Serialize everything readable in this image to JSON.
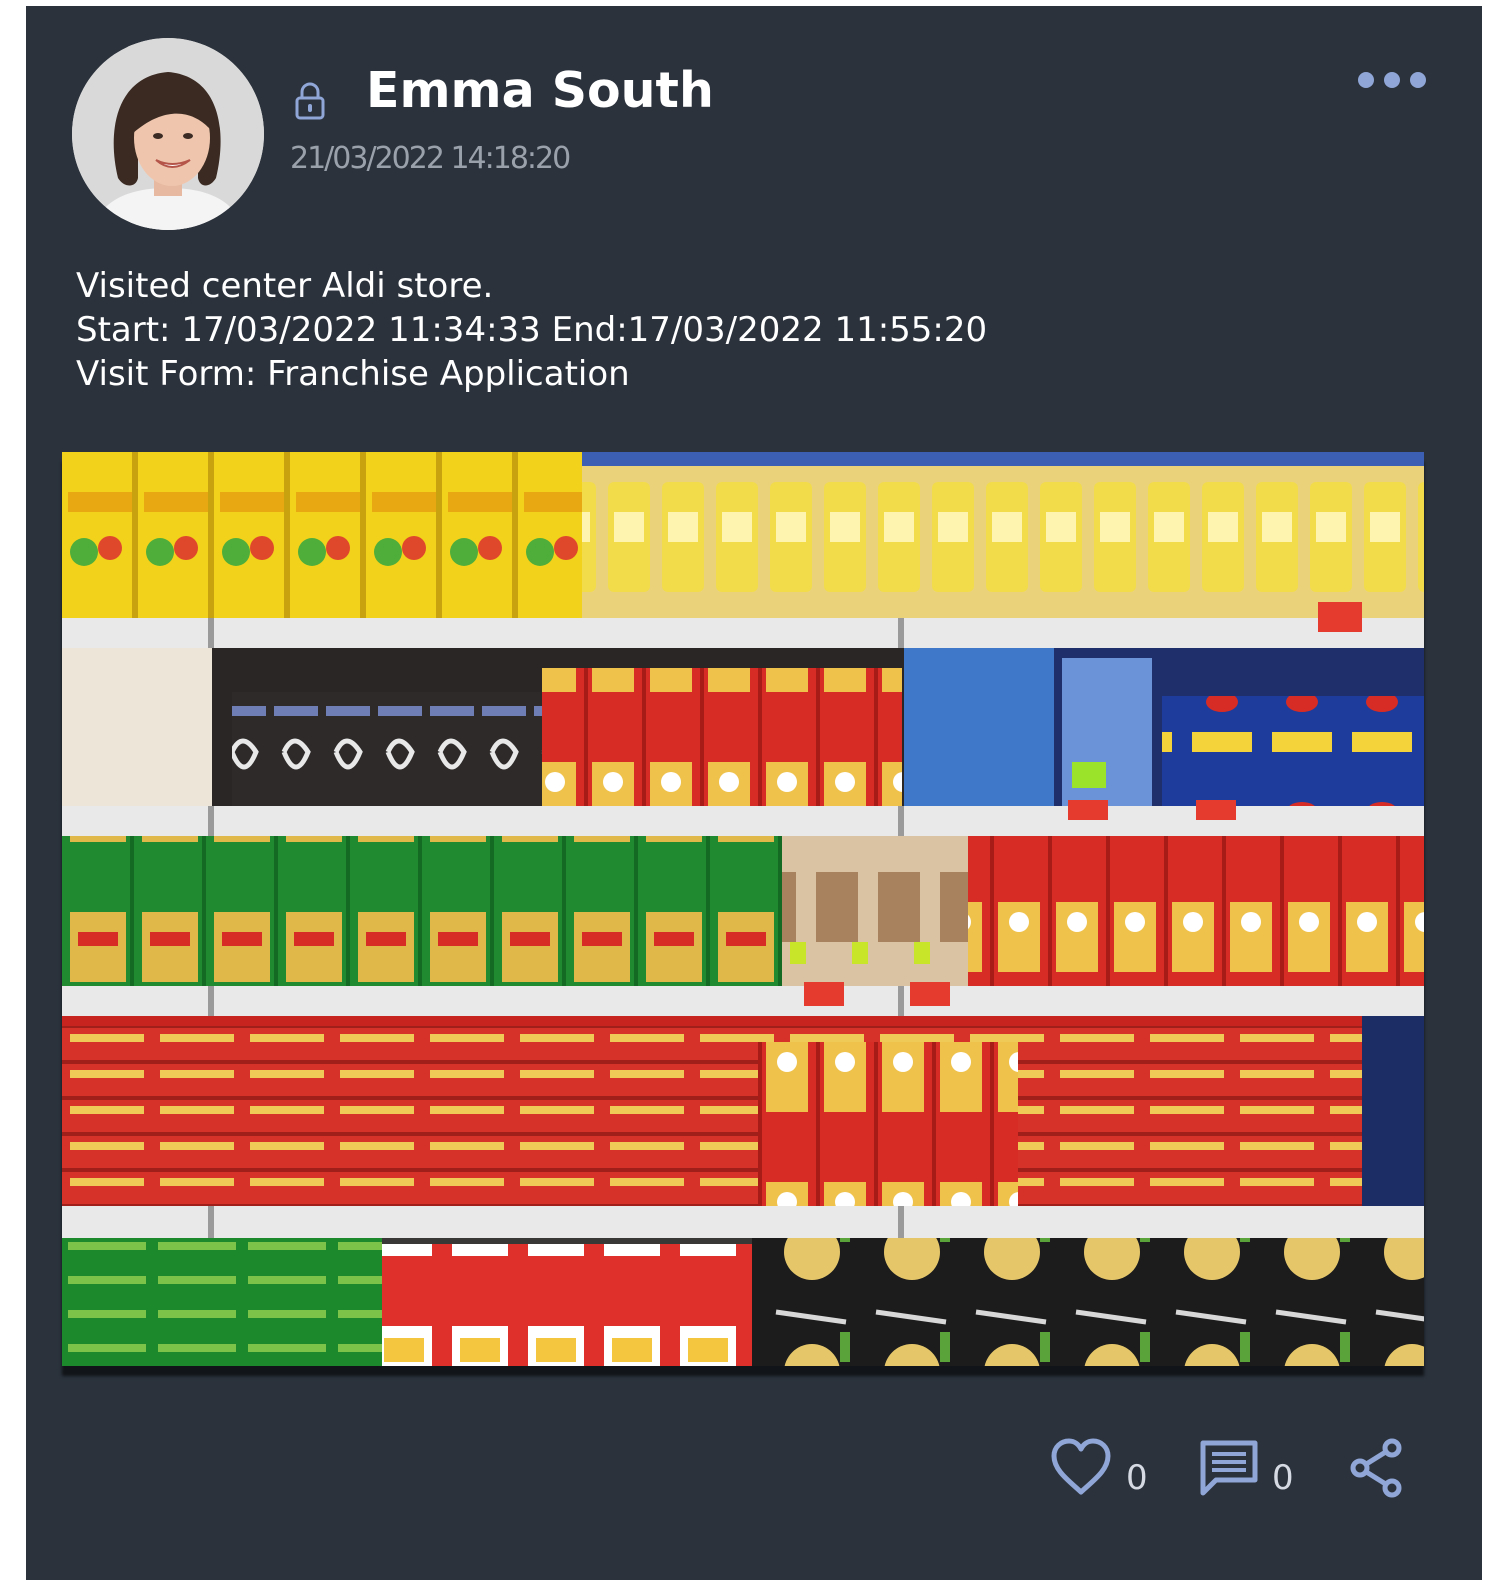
{
  "post": {
    "author_name": "Emma South",
    "timestamp": "21/03/2022 14:18:20",
    "body_lines": [
      "Visited center Aldi store.",
      "Start: 17/03/2022 11:34:33 End:17/03/2022 11:55:20",
      "Visit Form: Franchise Application"
    ],
    "icons": {
      "privacy": "lock-icon",
      "menu": "more-dots-icon",
      "like": "heart-icon",
      "comment": "comment-icon",
      "share": "share-icon"
    }
  },
  "actions": {
    "like_count": "0",
    "comment_count": "0"
  },
  "colors": {
    "card_bg": "#2b323c",
    "icon_blue": "#8fa6d6",
    "timestamp": "#9aa1ab",
    "text": "#ffffff"
  }
}
